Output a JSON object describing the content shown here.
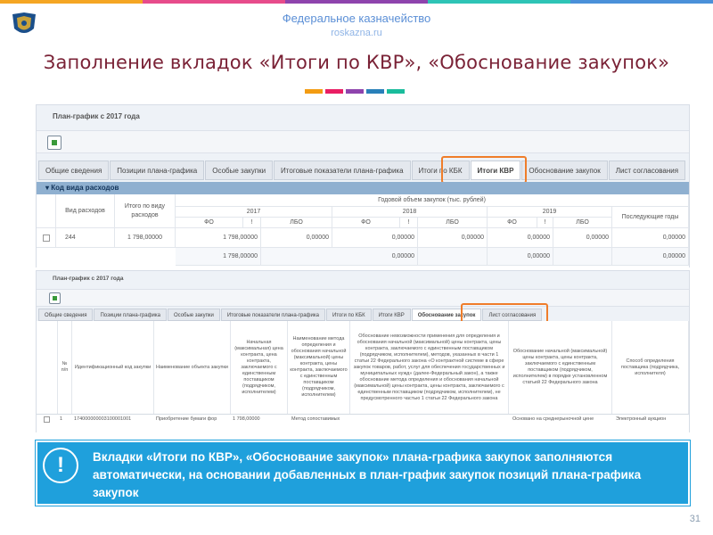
{
  "header": {
    "site_title": "Федеральное казначейство",
    "site_url": "roskazna.ru",
    "slide_title": "Заполнение вкладок «Итоги по КВР», «Обоснование закупок»"
  },
  "colors": {
    "topbar": [
      "#f5a623",
      "#e74c8b",
      "#8e44ad",
      "#2ec4b6",
      "#4a90d9"
    ],
    "accent": [
      "#f39c12",
      "#e91e63",
      "#8e44ad",
      "#2980b9",
      "#1abc9c"
    ],
    "title": "#7a2236",
    "callout": "#1fa0dc",
    "highlight": "#ef7d2a"
  },
  "screen1": {
    "title": "План-график с 2017 года",
    "tabs": [
      "Общие сведения",
      "Позиции плана-графика",
      "Особые закупки",
      "Итоговые показатели плана-графика",
      "Итоги по КБК",
      "Итоги КВР",
      "Обоснование закупок",
      "Лист согласования"
    ],
    "active_tab": "Итоги КВР",
    "group_label": "Код вида расходов",
    "headers": {
      "kvr": "Вид расходов",
      "total": "Итого по виду расходов",
      "annual": "Годовой объем закупок (тыс. рублей)",
      "y2017": "2017",
      "y2018": "2018",
      "y2019": "2019",
      "next": "Последующие годы",
      "fo": "ФО",
      "excl": "!",
      "lbo": "ЛБО"
    },
    "row": [
      "244",
      "1 798,00000",
      "1 798,00000",
      "0,00000",
      "0,00000",
      "0,00000",
      "0,00000",
      "0,00000",
      "0,00000"
    ],
    "totals": [
      "1 798,00000",
      "0,00000",
      "0,00000",
      "0,00000",
      "0,00000",
      "0,00000"
    ]
  },
  "screen2": {
    "title": "План-график с 2017 года",
    "tabs": [
      "Общие сведения",
      "Позиции плана-графика",
      "Особые закупки",
      "Итоговые показатели плана-графика",
      "Итоги по КБК",
      "Итоги КВР",
      "Обоснование закупок",
      "Лист согласования"
    ],
    "active_tab": "Обоснование закупок",
    "headers": {
      "num": "№ п/п",
      "ikz": "Идентификационный код закупки",
      "name": "Наименование объекта закупки",
      "nmck": "Начальная (максимальная) цена контракта, цена контракта, заключаемого с единственным поставщиком (подрядчиком, исполнителем)",
      "method": "Наименование метода определения и обоснования начальной (максимальной) цены контракта, цены контракта, заключаемого с единственным поставщиком (подрядчиком, исполнителем)",
      "justification": "Обоснование невозможности применения для определения и обоснования начальной (максимальной) цены контракта, цены контракта, заключаемого с единственным поставщиком (подрядчиком, исполнителем), методов, указанных в части 1 статьи 22 Федерального закона «О контрактной системе в сфере закупок товаров, работ, услуг для обеспечения государственных и муниципальных нужд» (далее-Федеральный закон), а также обоснование метода определения и обоснования начальной (максимальной) цены контракта, цены контракта, заключаемого с единственным поставщиком (подрядчиком, исполнителем), не предусмотренного частью 1 статьи 22 Федерального закона",
      "basis": "Обоснование начальной (максимальной) цены контракта, цены контракта, заключаемого с единственным поставщиком (подрядчиком, исполнителем) в порядке установленном статьей 22 Федерального закона",
      "way": "Способ определения поставщика (подрядчика, исполнителя)"
    },
    "row": [
      "1",
      "174000000003100001001",
      "Приобретение бумаги фор",
      "1 798,00000",
      "Метод сопоставимых",
      "",
      "Основано на среднерыночной цене",
      "Электронный аукцион"
    ]
  },
  "callout": {
    "icon": "!",
    "text": "Вкладки «Итоги по КВР», «Обоснование закупок» плана-графика закупок заполняются автоматически, на основании добавленных в план-график закупок позиций плана-графика закупок"
  },
  "page_number": "31"
}
